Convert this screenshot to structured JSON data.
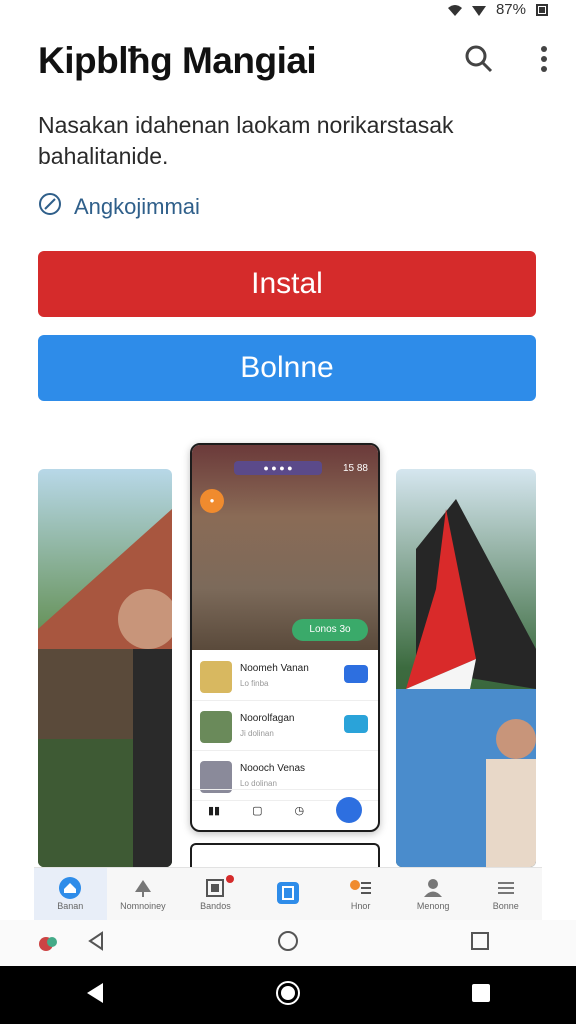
{
  "status": {
    "battery": "87%"
  },
  "app": {
    "title": "Kipblħg Mangiai",
    "description": "Nasakan idahenan laokam norikarstasak bahalitanide.",
    "link_label": "Angkojimmai"
  },
  "buttons": {
    "install": "Instal",
    "secondary": "Bolnne"
  },
  "preview": {
    "hero_time": "15 88",
    "pill": "Lonos 3o",
    "rows": [
      {
        "name": "Noomeh Vanan",
        "sub": "Lo finba"
      },
      {
        "name": "Noorolfagan",
        "sub": "Ji dolinan"
      },
      {
        "name": "Noooch Venas",
        "sub": "Lo dolinan"
      }
    ]
  },
  "tabs": [
    {
      "label": "Banan",
      "icon": "home-icon",
      "active": true
    },
    {
      "label": "Nomnoiney",
      "icon": "tree-icon"
    },
    {
      "label": "Bandos",
      "icon": "card-icon"
    },
    {
      "label": "",
      "icon": "book-icon"
    },
    {
      "label": "Hnor",
      "icon": "menu-icon"
    },
    {
      "label": "Menong",
      "icon": "person-icon"
    },
    {
      "label": "Bonne",
      "icon": "list-icon"
    }
  ],
  "colors": {
    "install": "#d52b2b",
    "secondary": "#2e8ce9",
    "link": "#2f5f8a"
  }
}
